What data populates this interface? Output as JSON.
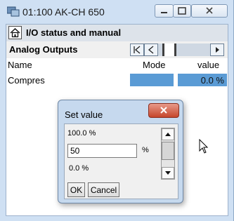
{
  "window": {
    "title": "01:100 AK-CH 650"
  },
  "page": {
    "title": "I/O status and manual"
  },
  "section": {
    "title": "Analog Outputs"
  },
  "columns": {
    "name": "Name",
    "mode": "Mode",
    "value": "value"
  },
  "rows": [
    {
      "name": "Compres",
      "value": "0.0 %"
    }
  ],
  "dialog": {
    "title": "Set value",
    "max": "100.0 %",
    "input_value": "50",
    "unit": "%",
    "min": "0.0 %",
    "ok_label": "OK",
    "cancel_label": "Cancel"
  },
  "colors": {
    "selection": "#5a9bd5",
    "close": "#c5462c"
  }
}
